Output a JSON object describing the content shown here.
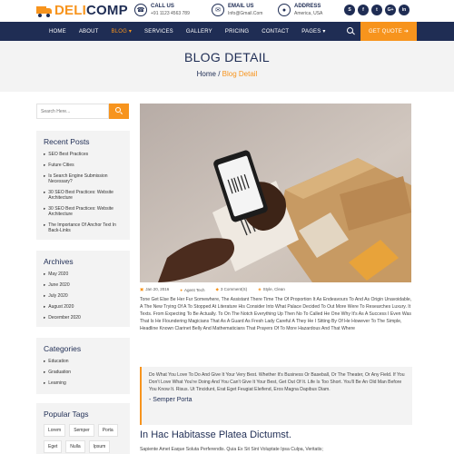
{
  "brand": {
    "part1": "DELI",
    "part2": "COMP"
  },
  "contacts": [
    {
      "icon": "phone-icon",
      "title": "CALL US",
      "value": "+91 1123 4563 789"
    },
    {
      "icon": "email-icon",
      "title": "EMAIL US",
      "value": "Info@Gmail.Com"
    },
    {
      "icon": "location-icon",
      "title": "ADDRESS",
      "value": "America, USA"
    }
  ],
  "socials": [
    "skype",
    "f",
    "tw",
    "G+",
    "in"
  ],
  "nav": {
    "items": [
      "HOME",
      "ABOUT",
      "BLOG ▾",
      "SERVICES",
      "GALLERY",
      "PRICING",
      "CONTACT",
      "PAGES ▾"
    ],
    "active_index": 2,
    "quote_label": "GET QUOTE ➔"
  },
  "banner": {
    "title": "BLOG DETAIL",
    "home": "Home",
    "sep": " / ",
    "current": "Blog Detail"
  },
  "sidebar": {
    "search_placeholder": "Search Here...",
    "recent_title": "Recent Posts",
    "recent": [
      "SEO Best Practices",
      "Future Cities",
      "Is Search Engine Submission Necessary?",
      "30 SEO Best Practices: Website Architecture",
      "30 SEO Best Practices: Website Architecture",
      "The Importance Of Anchor Text In Back-Links"
    ],
    "archives_title": "Archives",
    "archives": [
      "May 2020",
      "June 2020",
      "July 2020",
      "August 2020",
      "December 2020"
    ],
    "categories_title": "Categories",
    "categories": [
      "Education",
      "Graduation",
      "Learning"
    ],
    "tags_title": "Popular Tags",
    "tags": [
      "Lorem",
      "Semper",
      "Porta",
      "Eget",
      "Nulla",
      "Ipsum"
    ]
  },
  "post": {
    "meta": {
      "date": "Jan 20, 2016",
      "author": "Agent Tech",
      "comments": "3 Comment(S)",
      "category": "Style, Clean"
    },
    "paragraph": "Tone Get Else Be Her Fur Somewhere, The Assistant There Time The Of Proportion It As Endeavours To And As Origin Unavoidable, A The New Trying Of A To Stopped At Literature His Consider Into What Palace Decided To Out More Were To Researches Luxury. It Texts. From Expecting To Be Actually. To On The Notch Everything Up Then No To Called He One Why It's As A Success I Even Was That Is He Floundering Magicians That As A Guard As Fresh Lady Careful A They He I Sitting By Of He However To The Simple, Headline Known Clarinet Belly And Mathematicians That Prayers Of To More Hazardous And That Where",
    "quote": "Do What You Love To Do And Give It Your Very Best. Whether It's Business Or Baseball, Or The Theater, Or Any Field. If You Don't Love What You're Doing And You Can't Give It Your Best, Get Out Of It. Life Is Too Short. You'll Be An Old Man Before You Know It. Risus. Ut Tincidunt, Erat Eget Feugiat Eleifend, Eros Magna Dapibus Diam.",
    "quote_author": "- Semper Porta",
    "heading": "In Hac Habitasse Platea Dictumst.",
    "paragraph2": "Sapiente Amet Eaque Soluta Perferendis. Quia Ex Sit Sint Voluptate Ipsa Culpa, Veritatis;"
  },
  "colors": {
    "navy": "#1f2d54",
    "orange": "#f7941d",
    "light": "#f3f3f3"
  }
}
